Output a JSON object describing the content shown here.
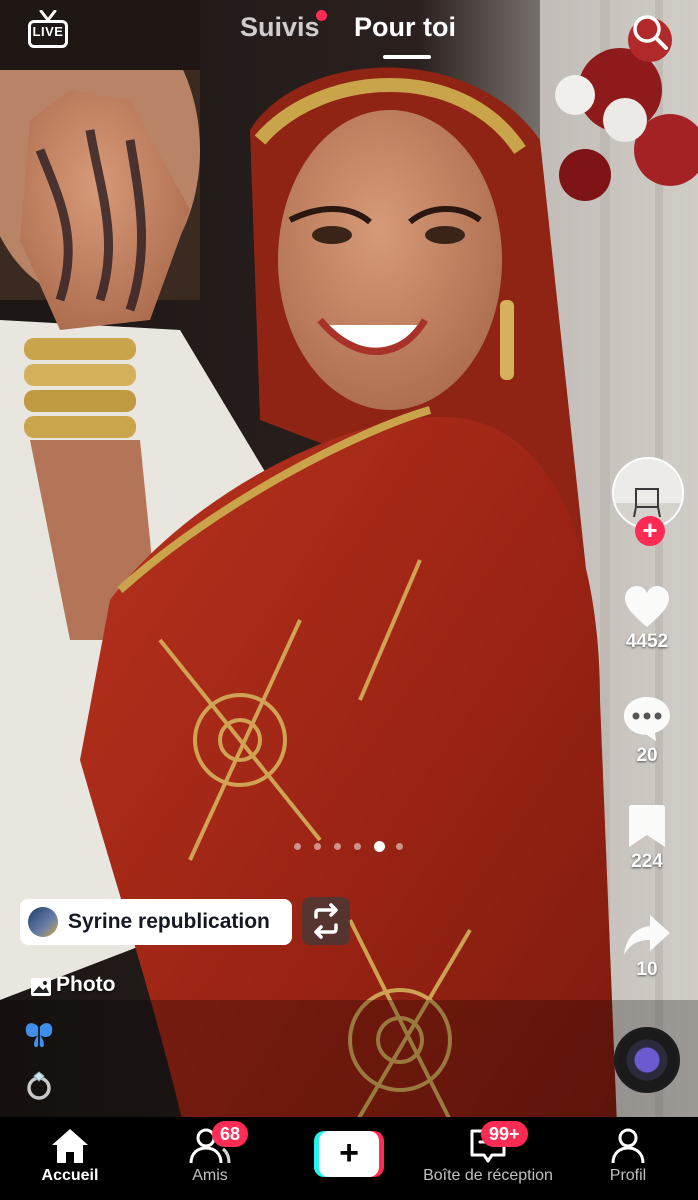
{
  "app": {
    "colors": {
      "accent": "#fe2c55",
      "cyan": "#25f4ee",
      "nav_bg": "#000000"
    }
  },
  "top_bar": {
    "live_label": "LIVE",
    "tabs": [
      {
        "label": "Suivis",
        "active": false,
        "has_dot": true
      },
      {
        "label": "Pour toi",
        "active": true
      }
    ],
    "search_icon": "search-icon"
  },
  "post": {
    "media_type_icon": "image-icon",
    "media_type_label": "Photo",
    "carousel": {
      "total": 6,
      "active_index": 4
    },
    "caption_emojis": [
      "🦋",
      "💍"
    ],
    "repost": {
      "label": "Syrine republication",
      "icon": "repost-icon"
    }
  },
  "actions": {
    "creator_avatar_icon": "avatar",
    "follow_label": "+",
    "like": {
      "icon": "heart-icon",
      "count": "4452"
    },
    "comment": {
      "icon": "comment-icon",
      "count": "20"
    },
    "save": {
      "icon": "bookmark-icon",
      "count": "224"
    },
    "share": {
      "icon": "share-icon",
      "count": "10"
    },
    "music_icon": "music-disc-icon"
  },
  "bottom_nav": {
    "items": [
      {
        "label": "Accueil",
        "icon": "home-icon",
        "active": true
      },
      {
        "label": "Amis",
        "icon": "friends-icon",
        "badge": "68"
      },
      {
        "label": "",
        "icon": "create-icon",
        "button_text": "+"
      },
      {
        "label": "Boîte de réception",
        "icon": "inbox-icon",
        "badge": "99+"
      },
      {
        "label": "Profil",
        "icon": "profile-icon"
      }
    ]
  }
}
